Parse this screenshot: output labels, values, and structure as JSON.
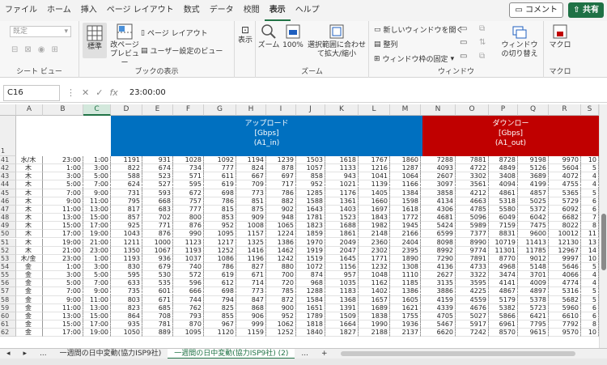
{
  "menu": [
    "ファイル",
    "ホーム",
    "挿入",
    "ページ レイアウト",
    "数式",
    "データ",
    "校閲",
    "表示",
    "ヘルプ"
  ],
  "active_menu_index": 7,
  "buttons": {
    "comment": "コメント",
    "share": "共有"
  },
  "ribbon": {
    "sheet_view": {
      "dropdown": "既定",
      "label": "シート ビュー"
    },
    "book_views": {
      "normal": "標準",
      "page_break": "改ページプレビュー",
      "page_layout": "ページ レイアウト",
      "custom_views": "ユーザー設定のビュー",
      "label": "ブックの表示"
    },
    "show": {
      "label_btn": "表示"
    },
    "zoom": {
      "zoom": "ズーム",
      "pct": "100%",
      "fit_selection": "選択範囲に合わせて拡大/縮小",
      "label": "ズーム"
    },
    "window": {
      "new_window": "新しいウィンドウを開く",
      "arrange": "整列",
      "freeze": "ウィンドウ枠の固定",
      "switch": "ウィンドウの切り替え",
      "label": "ウィンドウ"
    },
    "macro": {
      "macro": "マクロ",
      "label": "マクロ"
    }
  },
  "formula": {
    "namebox": "C16",
    "value": "23:00:00"
  },
  "columns": [
    "A",
    "B",
    "C",
    "D",
    "E",
    "F",
    "G",
    "H",
    "I",
    "J",
    "K",
    "L",
    "M",
    "N",
    "O",
    "P",
    "Q",
    "R",
    "S"
  ],
  "header_blue": {
    "l1": "アップロード",
    "l2": "[Gbps]",
    "l3": "(A1_in)"
  },
  "header_red": {
    "l1": "ダウンロー",
    "l2": "[Gbps]",
    "l3": "(A1_out)"
  },
  "row_header_first": "1",
  "rows": [
    {
      "n": "41",
      "day": "水/木",
      "b": "23:00",
      "c": "1:00",
      "v": [
        "1191",
        "931",
        "1028",
        "1092",
        "1194",
        "1239",
        "1503",
        "1618",
        "1767",
        "1860",
        "7288",
        "7881",
        "8728",
        "9198",
        "9970",
        "10"
      ]
    },
    {
      "n": "42",
      "day": "木",
      "b": "1:00",
      "c": "3:00",
      "v": [
        "822",
        "674",
        "734",
        "777",
        "824",
        "878",
        "1057",
        "1133",
        "1216",
        "1287",
        "4093",
        "4722",
        "4849",
        "5126",
        "5604",
        "5"
      ]
    },
    {
      "n": "43",
      "day": "木",
      "b": "3:00",
      "c": "5:00",
      "v": [
        "588",
        "523",
        "571",
        "611",
        "667",
        "697",
        "858",
        "943",
        "1041",
        "1064",
        "2607",
        "3302",
        "3408",
        "3689",
        "4072",
        "4"
      ]
    },
    {
      "n": "44",
      "day": "木",
      "b": "5:00",
      "c": "7:00",
      "v": [
        "624",
        "527",
        "595",
        "619",
        "709",
        "717",
        "952",
        "1021",
        "1139",
        "1166",
        "3097",
        "3561",
        "4094",
        "4199",
        "4755",
        "4"
      ]
    },
    {
      "n": "45",
      "day": "木",
      "b": "7:00",
      "c": "9:00",
      "v": [
        "731",
        "593",
        "672",
        "698",
        "773",
        "786",
        "1285",
        "1176",
        "1405",
        "1384",
        "3858",
        "4212",
        "4861",
        "4857",
        "5365",
        "5"
      ]
    },
    {
      "n": "46",
      "day": "木",
      "b": "9:00",
      "c": "11:00",
      "v": [
        "795",
        "668",
        "757",
        "786",
        "851",
        "882",
        "1588",
        "1361",
        "1660",
        "1598",
        "4134",
        "4663",
        "5318",
        "5025",
        "5729",
        "6"
      ]
    },
    {
      "n": "47",
      "day": "木",
      "b": "11:00",
      "c": "13:00",
      "v": [
        "817",
        "683",
        "777",
        "815",
        "875",
        "902",
        "1643",
        "1403",
        "1697",
        "1618",
        "4306",
        "4785",
        "5580",
        "5372",
        "6092",
        "6"
      ]
    },
    {
      "n": "48",
      "day": "木",
      "b": "13:00",
      "c": "15:00",
      "v": [
        "857",
        "702",
        "800",
        "853",
        "909",
        "948",
        "1781",
        "1523",
        "1843",
        "1772",
        "4681",
        "5096",
        "6049",
        "6042",
        "6682",
        "7"
      ]
    },
    {
      "n": "49",
      "day": "木",
      "b": "15:00",
      "c": "17:00",
      "v": [
        "925",
        "771",
        "876",
        "952",
        "1008",
        "1065",
        "1823",
        "1688",
        "1982",
        "1945",
        "5424",
        "5989",
        "7159",
        "7475",
        "8022",
        "8"
      ]
    },
    {
      "n": "50",
      "day": "木",
      "b": "17:00",
      "c": "19:00",
      "v": [
        "1043",
        "876",
        "990",
        "1095",
        "1157",
        "1224",
        "1859",
        "1861",
        "2148",
        "2166",
        "6599",
        "7377",
        "8831",
        "9600",
        "10012",
        "11"
      ]
    },
    {
      "n": "51",
      "day": "木",
      "b": "19:00",
      "c": "21:00",
      "v": [
        "1211",
        "1000",
        "1123",
        "1217",
        "1325",
        "1386",
        "1970",
        "2049",
        "2360",
        "2404",
        "8098",
        "8990",
        "10719",
        "11413",
        "12130",
        "13"
      ]
    },
    {
      "n": "52",
      "day": "木",
      "b": "21:00",
      "c": "23:00",
      "v": [
        "1350",
        "1067",
        "1193",
        "1252",
        "1416",
        "1462",
        "1919",
        "2047",
        "2302",
        "2395",
        "8992",
        "9774",
        "11301",
        "11785",
        "12967",
        "14"
      ]
    },
    {
      "n": "53",
      "day": "木/金",
      "b": "23:00",
      "c": "1:00",
      "v": [
        "1193",
        "936",
        "1037",
        "1086",
        "1196",
        "1242",
        "1519",
        "1645",
        "1771",
        "1890",
        "7290",
        "7891",
        "8770",
        "9012",
        "9997",
        "10"
      ]
    },
    {
      "n": "54",
      "day": "金",
      "b": "1:00",
      "c": "3:00",
      "v": [
        "830",
        "679",
        "740",
        "786",
        "827",
        "880",
        "1072",
        "1156",
        "1232",
        "1308",
        "4136",
        "4733",
        "4968",
        "5148",
        "5646",
        "5"
      ]
    },
    {
      "n": "55",
      "day": "金",
      "b": "3:00",
      "c": "5:00",
      "v": [
        "595",
        "530",
        "572",
        "619",
        "671",
        "700",
        "874",
        "957",
        "1048",
        "1110",
        "2627",
        "3322",
        "3474",
        "3701",
        "4066",
        "4"
      ]
    },
    {
      "n": "56",
      "day": "金",
      "b": "5:00",
      "c": "7:00",
      "v": [
        "633",
        "535",
        "596",
        "612",
        "714",
        "720",
        "968",
        "1035",
        "1162",
        "1185",
        "3135",
        "3595",
        "4141",
        "4009",
        "4774",
        "4"
      ]
    },
    {
      "n": "57",
      "day": "金",
      "b": "7:00",
      "c": "9:00",
      "v": [
        "735",
        "601",
        "666",
        "698",
        "773",
        "785",
        "1288",
        "1183",
        "1402",
        "1386",
        "3886",
        "4225",
        "4867",
        "4897",
        "5316",
        "5"
      ]
    },
    {
      "n": "58",
      "day": "金",
      "b": "9:00",
      "c": "11:00",
      "v": [
        "803",
        "671",
        "744",
        "794",
        "847",
        "872",
        "1584",
        "1368",
        "1657",
        "1605",
        "4159",
        "4559",
        "5179",
        "5378",
        "5682",
        "5"
      ]
    },
    {
      "n": "59",
      "day": "金",
      "b": "11:00",
      "c": "13:00",
      "v": [
        "823",
        "685",
        "762",
        "825",
        "868",
        "900",
        "1651",
        "1391",
        "1689",
        "1621",
        "4339",
        "4676",
        "5382",
        "5723",
        "5960",
        "6"
      ]
    },
    {
      "n": "60",
      "day": "金",
      "b": "13:00",
      "c": "15:00",
      "v": [
        "864",
        "708",
        "793",
        "855",
        "906",
        "952",
        "1789",
        "1509",
        "1838",
        "1755",
        "4705",
        "5027",
        "5866",
        "6421",
        "6610",
        "6"
      ]
    },
    {
      "n": "61",
      "day": "金",
      "b": "15:00",
      "c": "17:00",
      "v": [
        "935",
        "781",
        "870",
        "967",
        "999",
        "1062",
        "1818",
        "1664",
        "1990",
        "1936",
        "5467",
        "5917",
        "6961",
        "7795",
        "7792",
        "8"
      ]
    },
    {
      "n": "62",
      "day": "金",
      "b": "17:00",
      "c": "19:00",
      "v": [
        "1050",
        "889",
        "1095",
        "1120",
        "1159",
        "1252",
        "1840",
        "1827",
        "2188",
        "2137",
        "6620",
        "7242",
        "8570",
        "9615",
        "9570",
        "10"
      ]
    }
  ],
  "tabs": {
    "ellipsis": "...",
    "tab1": "一週間の日中変動(協力ISP9社)",
    "tab2": "一週間の日中変動(協力ISP9社) (2)",
    "add": "+"
  }
}
